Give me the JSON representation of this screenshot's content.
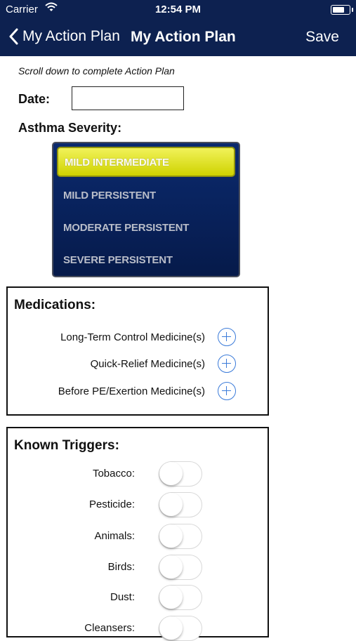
{
  "status_bar": {
    "carrier": "Carrier",
    "time": "12:54 PM"
  },
  "nav": {
    "back_label": "My Action Plan",
    "title": "My Action Plan",
    "save_label": "Save"
  },
  "form": {
    "hint": "Scroll down to complete Action Plan",
    "date_label": "Date:",
    "date_value": "",
    "severity_label": "Asthma Severity:",
    "severity_options": [
      "MILD INTERMEDIATE",
      "MILD PERSISTENT",
      "MODERATE PERSISTENT",
      "SEVERE PERSISTENT"
    ],
    "severity_selected": "MILD INTERMEDIATE"
  },
  "medications": {
    "title": "Medications:",
    "items": [
      "Long-Term Control Medicine(s)",
      "Quick-Relief Medicine(s)",
      "Before PE/Exertion Medicine(s)"
    ]
  },
  "triggers": {
    "title": "Known Triggers:",
    "items": [
      {
        "label": "Tobacco:",
        "on": false
      },
      {
        "label": "Pesticide:",
        "on": false
      },
      {
        "label": "Animals:",
        "on": false
      },
      {
        "label": "Birds:",
        "on": false
      },
      {
        "label": "Dust:",
        "on": false
      },
      {
        "label": "Cleansers:",
        "on": false
      }
    ]
  },
  "colors": {
    "nav_bg": "#0d2150",
    "accent": "#3b7bd9",
    "picker_selected": "#e4e62a",
    "picker_bg": "#0b2a6e"
  },
  "icons": {
    "back": "chevron-left-icon",
    "wifi": "wifi-icon",
    "battery": "battery-icon",
    "add": "plus-circle-icon"
  }
}
